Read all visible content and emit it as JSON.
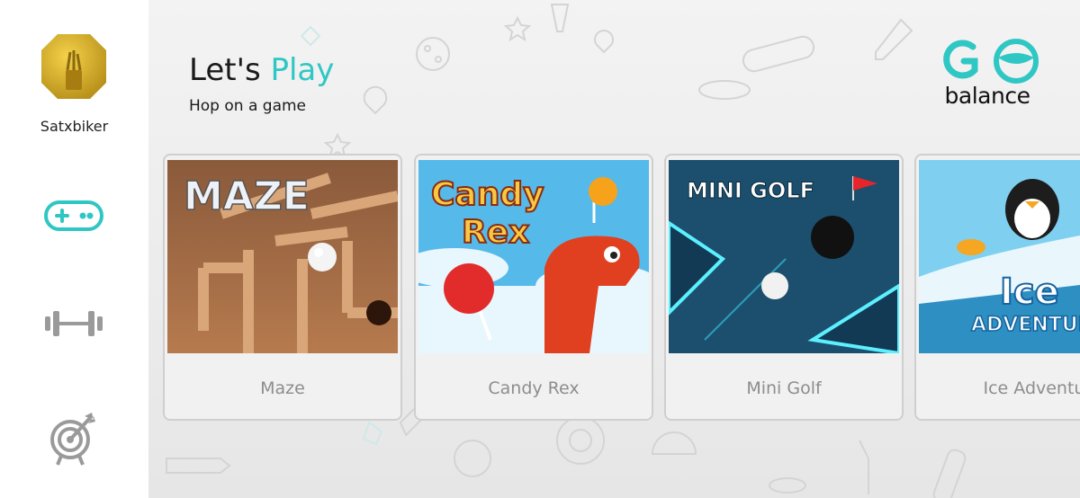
{
  "user": {
    "name": "Satxbiker"
  },
  "header": {
    "title_prefix": "Let's",
    "title_accent": "Play",
    "subtitle": "Hop on a game"
  },
  "brand": {
    "logo_letters": "GO",
    "logo_text": "balance",
    "accent_color": "#2fc7c4"
  },
  "sidebar": {
    "items": [
      {
        "name": "games",
        "icon": "gamepad-icon",
        "active": true
      },
      {
        "name": "workouts",
        "icon": "dumbbell-icon",
        "active": false
      },
      {
        "name": "goals",
        "icon": "target-icon",
        "active": false
      }
    ]
  },
  "games": [
    {
      "title": "Maze",
      "thumb_title": "MAZE"
    },
    {
      "title": "Candy Rex",
      "thumb_title_line1": "Candy",
      "thumb_title_line2": "Rex"
    },
    {
      "title": "Mini Golf",
      "thumb_title": "MINI GOLF"
    },
    {
      "title": "Ice Adventu",
      "thumb_title_line1": "Ice",
      "thumb_title_line2": "ADVENTUR"
    }
  ]
}
